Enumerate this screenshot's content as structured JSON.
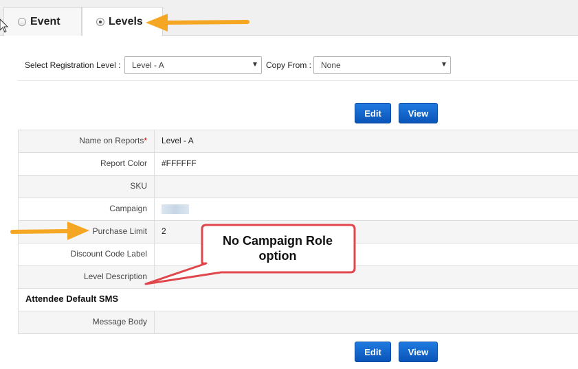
{
  "tabs": {
    "event_label": "Event",
    "levels_label": "Levels"
  },
  "filters": {
    "level_label": "Select Registration Level :",
    "level_value": "Level - A",
    "copy_label": "Copy From :",
    "copy_value": "None"
  },
  "buttons": {
    "edit": "Edit",
    "view": "View"
  },
  "fields": {
    "name_on_reports": {
      "label": "Name on Reports",
      "required_mark": "*",
      "value": "Level - A"
    },
    "report_color": {
      "label": "Report Color",
      "value": "#FFFFFF"
    },
    "sku": {
      "label": "SKU",
      "value": ""
    },
    "campaign": {
      "label": "Campaign"
    },
    "purchase_limit": {
      "label": "Purchase Limit",
      "value": "2"
    },
    "discount_code_label": {
      "label": "Discount Code Label",
      "value": ""
    },
    "level_description": {
      "label": "Level Description",
      "value": ""
    },
    "section_sms": "Attendee Default SMS",
    "message_body": {
      "label": "Message Body",
      "value": ""
    }
  },
  "annotation": {
    "line1": "No Campaign Role",
    "line2": "option",
    "arrow_color": "#f5a623",
    "callout_border": "#e0474c"
  }
}
